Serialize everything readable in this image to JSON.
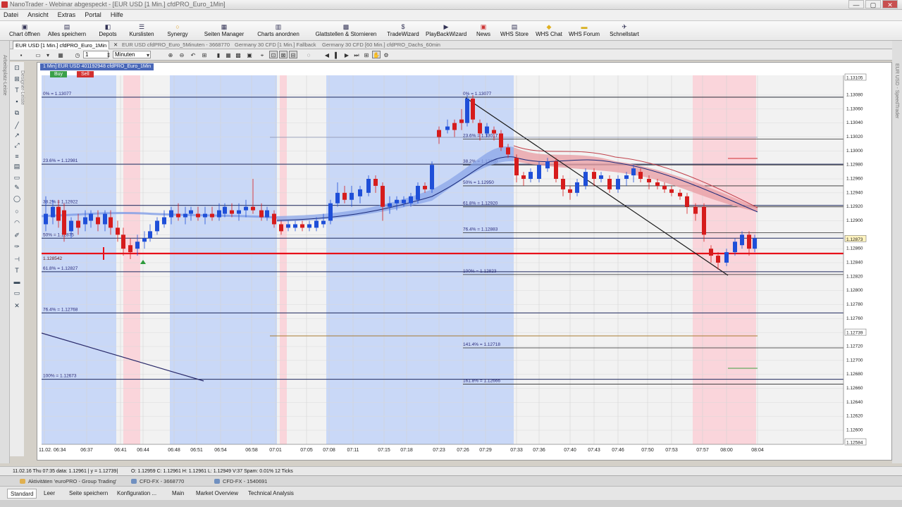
{
  "window": {
    "title": "NanoTrader - Webinar abgespeckt - [EUR USD [1 Min.]  cfdPRO_Euro_1Min]",
    "minimize": "—",
    "maximize": "▢",
    "close": "✕"
  },
  "menu": [
    "Datei",
    "Ansicht",
    "Extras",
    "Portal",
    "Hilfe"
  ],
  "toolbar": [
    {
      "label": "Chart öffnen",
      "icon": "folder-icon"
    },
    {
      "label": "Alles speichern",
      "icon": "save-icon"
    },
    {
      "label": "Depots",
      "icon": "portfolio-icon"
    },
    {
      "label": "Kurslisten",
      "icon": "list-icon"
    },
    {
      "label": "Synergy",
      "icon": "synergy-icon"
    },
    {
      "label": "Seiten Manager",
      "icon": "pages-icon"
    },
    {
      "label": "Charts anordnen",
      "icon": "arrange-icon"
    },
    {
      "label": "Glattstellen & Stornieren",
      "icon": "close-positions-icon"
    },
    {
      "label": "TradeWizard",
      "icon": "dollar-icon"
    },
    {
      "label": "PlayBackWizard",
      "icon": "playback-icon"
    },
    {
      "label": "News",
      "icon": "news-icon"
    },
    {
      "label": "WHS Store",
      "icon": "store-icon"
    },
    {
      "label": "WHS Chat",
      "icon": "chat-icon"
    },
    {
      "label": "WHS Forum",
      "icon": "forum-icon"
    },
    {
      "label": "Schnellstart",
      "icon": "rocket-icon"
    }
  ],
  "tabs": [
    {
      "label": "EUR USD [1 Min.]  cfdPRO_Euro_1Min",
      "active": true
    },
    {
      "label": "✕",
      "active": false
    },
    {
      "label": "EUR USD  cfdPRO_Euro_5Minuten - 3668770",
      "active": false
    },
    {
      "label": "Germany 30 CFD [1 Min.]  Fallback",
      "active": false
    },
    {
      "label": "Germany 30 CFD [60 Min.]  cfdPRO_Dachs_60min",
      "active": false
    }
  ],
  "chart_toolbar": {
    "interval_value": "1",
    "interval_unit": "Minuten"
  },
  "sidebar": {
    "left_label": "Arbeitsplatz-Leiste",
    "designer_label": "Designer-Leiste",
    "right_label": "EUR USD - SpeedTrader"
  },
  "chart": {
    "header": "1 Min] EUR USD  401192948 cfdPRO_Euro_1Min",
    "buy": "Buy",
    "sell": "Sell",
    "price_labels": [
      "1.13105",
      "1.13080",
      "1.13060",
      "1.13040",
      "1.13020",
      "1.13000",
      "1.12980",
      "1.12960",
      "1.12940",
      "1.12920",
      "1.12900",
      "1.12873",
      "1.12860",
      "1.12840",
      "1.12820",
      "1.12800",
      "1.12780",
      "1.12760",
      "1.12739",
      "1.12720",
      "1.12700",
      "1.12680",
      "1.12660",
      "1.12640",
      "1.12620",
      "1.12600",
      "1.12584"
    ],
    "time_labels": [
      "11.02. 06:34",
      "06:37",
      "06:41",
      "06:44",
      "06:48",
      "06:51",
      "06:54",
      "06:58",
      "07:01",
      "07:05",
      "07:08",
      "07:11",
      "07:15",
      "07:18",
      "07:23",
      "07:26",
      "07:29",
      "07:33",
      "07:36",
      "07:40",
      "07:43",
      "07:46",
      "07:50",
      "07:53",
      "07:57",
      "08:00",
      "08:04"
    ],
    "fib_left": [
      "0% = 1.13077",
      "23.6% = 1.12981",
      "38.2% = 1.12922",
      "50% = 1.12875",
      "61.8% = 1.12827",
      "76.4% = 1.12768",
      "100% = 1.12673"
    ],
    "fib_right": [
      "0% = 1.13077",
      "23.6% = 1.13017",
      "38.2% = 1.12980",
      "50% = 1.12950",
      "61.8% = 1.12920",
      "76.4% = 1.12883",
      "100% = 1.12823",
      "141.4% = 1.12718",
      "161.8% = 1.12666"
    ],
    "marker_label": "1.128542",
    "current_price": "1.12873",
    "line_price": "1.12739"
  },
  "status": {
    "left": "11.02.16 Thu  07:35 data: 1.12961 | y = 1.12739|",
    "right": "O: 1.12959 C: 1.12961 H: 1.12961 L: 1.12949 V:37 Spam: 0.01% 12 Ticks"
  },
  "taskbar": [
    "Aktivitäten 'euroPRO - Group Trading'",
    "CFD-FX - 3668770",
    "CFD-FX - 1540691"
  ],
  "bottom_tabs": [
    "Standard",
    "Leer",
    "Seite speichern",
    "Konfiguration ...",
    "Main",
    "Market Overview",
    "Technical Analysis"
  ],
  "colors": {
    "zone_blue": "#c4d5f7",
    "zone_red": "#fbd1d8",
    "zone_grey": "#f2f2f2",
    "fib_line": "#1f2a5e",
    "red_line": "#e8101a",
    "candle_up": "#1f4fd8",
    "candle_down": "#d61c1c"
  }
}
